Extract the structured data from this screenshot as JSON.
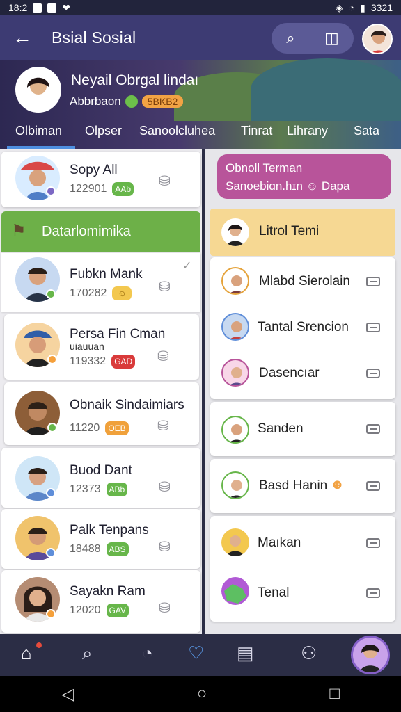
{
  "status": {
    "time": "18:2",
    "right": "3321"
  },
  "top": {
    "title": "Bsial Sosial",
    "back": "←"
  },
  "profile": {
    "name": "Neyail Obrgal lindaı",
    "sub": "Abbrbaon",
    "chip": "5BKB2"
  },
  "tabs": [
    "Olbiman",
    "Olpser",
    "Sanoolcluhea",
    "Tinrat",
    "Lihrany",
    "Sata"
  ],
  "left": {
    "top_item": {
      "name": "Sopy All",
      "id": "122901",
      "badge": "AAb"
    },
    "section": "Datarlomimika",
    "items": [
      {
        "name": "Fubkn Mank",
        "id": "170282",
        "badge": "☺"
      },
      {
        "name": "Persa Fin Cman",
        "sub": "uiauuan",
        "id": "119332",
        "badge": "GAD"
      },
      {
        "name": "Obnaik Sindaimiars",
        "id": "11220",
        "badge": "OEB"
      },
      {
        "name": "Buod Dant",
        "id": "12373",
        "badge": "ABb"
      },
      {
        "name": "Palk Tenpans",
        "id": "18488",
        "badge": "ABS"
      },
      {
        "name": "Sayakn Ram",
        "id": "12020",
        "badge": "GAV"
      }
    ]
  },
  "right": {
    "bubble_title": "Obnoll Terman",
    "bubble_sub": "Sanoebiɑn.hɪn",
    "bubble_tag": "Dapa",
    "header": "Litrol Temi",
    "items": [
      "Mlabd Sierolain",
      "Tantal Srencion",
      "Dasencıar",
      "Sanden",
      "Basd Hanin",
      "Maıkan",
      "Tenal"
    ]
  }
}
